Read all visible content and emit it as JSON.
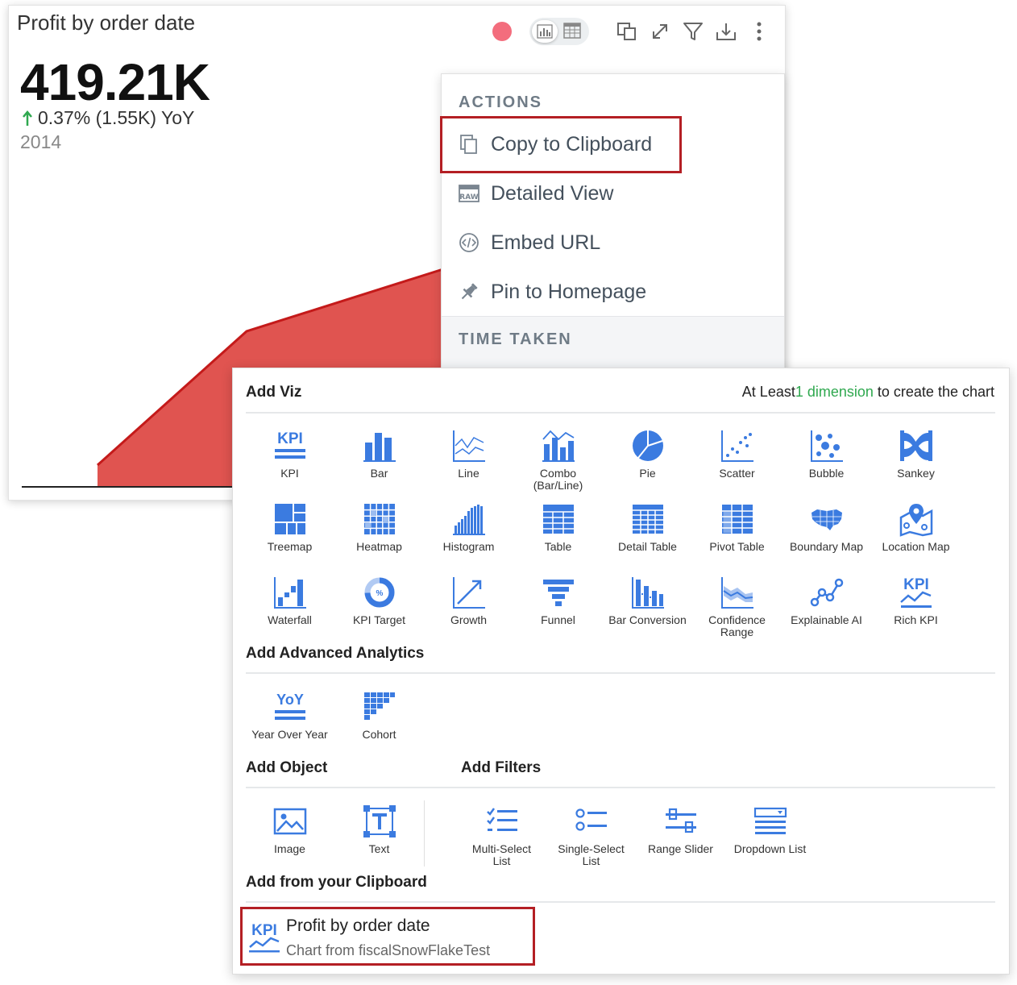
{
  "chart_card": {
    "title": "Profit by order date",
    "kpi_value": "419.21K",
    "kpi_change": "0.37% (1.55K) YoY",
    "kpi_year": "2014",
    "colors": {
      "area_fill": "#e05450",
      "area_stroke": "#c41a1a",
      "up_arrow": "#2fa84f",
      "status_dot": "#f36d7d"
    },
    "toolbar_icons": [
      "bar-chart-icon",
      "table-icon",
      "copy-window-icon",
      "expand-icon",
      "filter-icon",
      "download-icon",
      "more-vertical-icon"
    ]
  },
  "actions_menu": {
    "header": "ACTIONS",
    "items": [
      {
        "label": "Copy to Clipboard",
        "icon": "copy-icon"
      },
      {
        "label": "Detailed View",
        "icon": "raw-icon"
      },
      {
        "label": "Embed URL",
        "icon": "code-icon"
      },
      {
        "label": "Pin to Homepage",
        "icon": "pin-icon"
      }
    ],
    "footer_header": "TIME TAKEN"
  },
  "panel": {
    "title": "Add Viz",
    "hint_prefix": "At Least",
    "hint_highlight": "1 dimension",
    "hint_suffix": " to create the chart",
    "viz_tiles": [
      {
        "label": "KPI",
        "icon": "kpi-icon"
      },
      {
        "label": "Bar",
        "icon": "bar-icon"
      },
      {
        "label": "Line",
        "icon": "line-icon"
      },
      {
        "label": "Combo\n(Bar/Line)",
        "icon": "combo-icon"
      },
      {
        "label": "Pie",
        "icon": "pie-icon"
      },
      {
        "label": "Scatter",
        "icon": "scatter-icon"
      },
      {
        "label": "Bubble",
        "icon": "bubble-icon"
      },
      {
        "label": "Sankey",
        "icon": "sankey-icon"
      },
      {
        "label": "Treemap",
        "icon": "treemap-icon"
      },
      {
        "label": "Heatmap",
        "icon": "heatmap-icon"
      },
      {
        "label": "Histogram",
        "icon": "histogram-icon"
      },
      {
        "label": "Table",
        "icon": "table-icon"
      },
      {
        "label": "Detail Table",
        "icon": "detail-table-icon"
      },
      {
        "label": "Pivot Table",
        "icon": "pivot-table-icon"
      },
      {
        "label": "Boundary Map",
        "icon": "boundary-map-icon"
      },
      {
        "label": "Location Map",
        "icon": "location-map-icon"
      },
      {
        "label": "Waterfall",
        "icon": "waterfall-icon"
      },
      {
        "label": "KPI Target",
        "icon": "kpi-target-icon"
      },
      {
        "label": "Growth",
        "icon": "growth-icon"
      },
      {
        "label": "Funnel",
        "icon": "funnel-icon"
      },
      {
        "label": "Bar Conversion",
        "icon": "bar-conversion-icon"
      },
      {
        "label": "Confidence\nRange",
        "icon": "confidence-range-icon"
      },
      {
        "label": "Explainable AI",
        "icon": "explainable-ai-icon"
      },
      {
        "label": "Rich KPI",
        "icon": "rich-kpi-icon"
      }
    ],
    "advanced_title": "Add Advanced Analytics",
    "advanced_tiles": [
      {
        "label": "Year Over Year",
        "icon": "yoy-icon"
      },
      {
        "label": "Cohort",
        "icon": "cohort-icon"
      }
    ],
    "object_title": "Add Object",
    "filters_title": "Add Filters",
    "object_tiles": [
      {
        "label": "Image",
        "icon": "image-icon"
      },
      {
        "label": "Text",
        "icon": "text-icon"
      }
    ],
    "filter_tiles": [
      {
        "label": "Multi-Select\nList",
        "icon": "multi-select-icon"
      },
      {
        "label": "Single-Select\nList",
        "icon": "single-select-icon"
      },
      {
        "label": "Range Slider",
        "icon": "range-slider-icon"
      },
      {
        "label": "Dropdown List",
        "icon": "dropdown-list-icon"
      }
    ],
    "clipboard_title": "Add from your Clipboard",
    "clipboard_item": {
      "title": "Profit by order date",
      "subtitle": "Chart from fiscalSnowFlakeTest",
      "icon": "kpi-icon"
    },
    "colors": {
      "icon_blue": "#3b7be0",
      "highlight": "#b41f24"
    }
  }
}
